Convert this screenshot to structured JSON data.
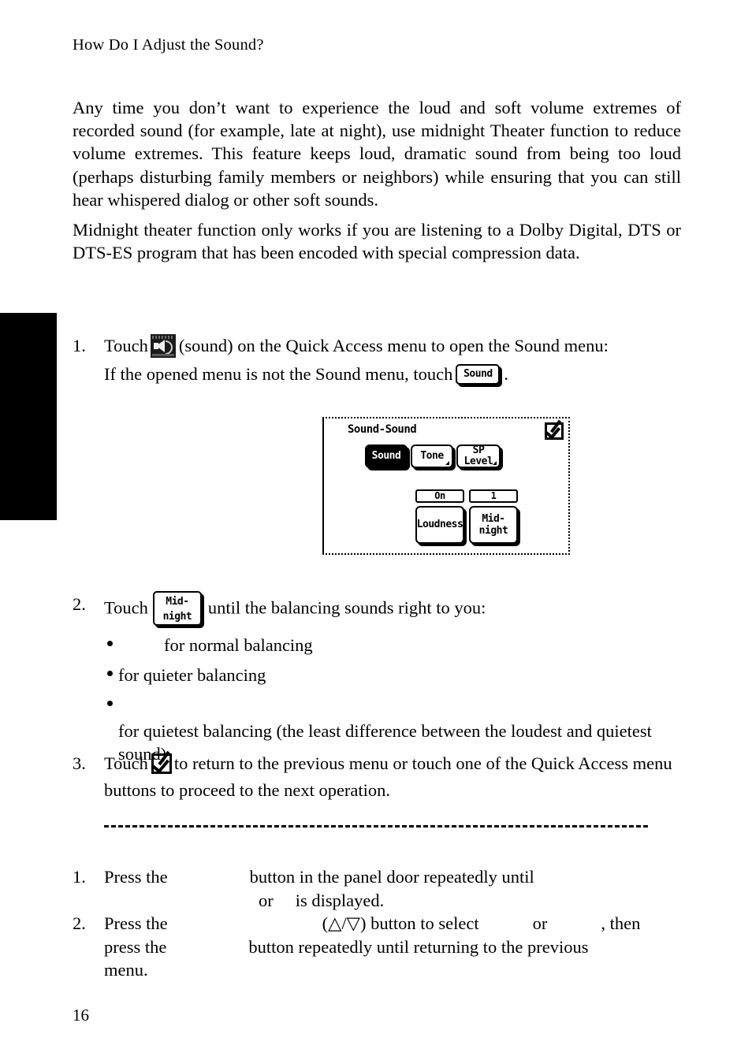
{
  "page": {
    "running_head": "How Do I Adjust the Sound?",
    "folio": "16"
  },
  "paragraphs": {
    "p1": "Any time you don’t want to experience the loud and soft volume extremes of recorded sound (for example, late at night), use midnight Theater function to reduce volume extremes. This feature keeps loud, dramatic sound from being too loud (perhaps disturbing family members or neighbors) while ensuring that you can still hear whispered dialog or other soft sounds.",
    "p2": "Midnight theater function only works if you are listening to a Dolby Digital, DTS or DTS-ES program that has been encoded with special compression data."
  },
  "steps": {
    "step1": {
      "number": "1.",
      "text_before_icon": "Touch",
      "icon_name": "sound-icon",
      "text_after_icon": "(sound) on the Quick Access menu to open the Sound menu:",
      "line2_before_button": "If the opened menu is not the Sound menu, touch",
      "button_label": "Sound",
      "line2_after_button": "."
    },
    "step2": {
      "number": "2.",
      "text_before_button": "Touch",
      "button_label_line1": "Mid-",
      "button_label_line2": "night",
      "text_after_button": "until the balancing sounds right to you:"
    },
    "step3": {
      "number": "3.",
      "text_before_check": "Touch",
      "check_icon_name": "checkmark-icon",
      "text_after_check": "to return to the previous menu or touch one of the Quick Access menu buttons to proceed to the next operation."
    }
  },
  "bullets": [
    {
      "text": "for normal balancing"
    },
    {
      "text": "for quieter balancing"
    },
    {
      "text": "for quietest balancing (the least difference between the loudest and quietest sound)"
    }
  ],
  "lcd": {
    "title": "Sound-Sound",
    "confirm_icon": "checkmark-icon",
    "top_keys": [
      {
        "label": "Sound",
        "selected": true,
        "has_triangle": false
      },
      {
        "label": "Tone",
        "selected": false,
        "has_triangle": true
      },
      {
        "label": "SP\nLevel",
        "label_line1": "SP",
        "label_line2": "Level",
        "selected": false,
        "has_triangle": true
      }
    ],
    "bottom_keys": [
      {
        "value": "On",
        "label": "Loudness"
      },
      {
        "value": "1",
        "label_line1": "Mid-",
        "label_line2": "night"
      }
    ]
  },
  "tail_steps": [
    {
      "number": "1.",
      "seg1": "Press the",
      "seg2": "button in the panel door repeatedly until",
      "seg3": "or",
      "seg4": "is displayed."
    },
    {
      "number": "2.",
      "seg1": "Press the",
      "seg2": "(△/▽) button to select",
      "seg3": "or",
      "seg4": ", then",
      "seg5": "press the",
      "seg6": "button repeatedly until returning to the previous",
      "seg7": "menu."
    }
  ],
  "colors": {
    "ink": "#000000",
    "paper": "#ffffff",
    "tab": "#000000"
  }
}
